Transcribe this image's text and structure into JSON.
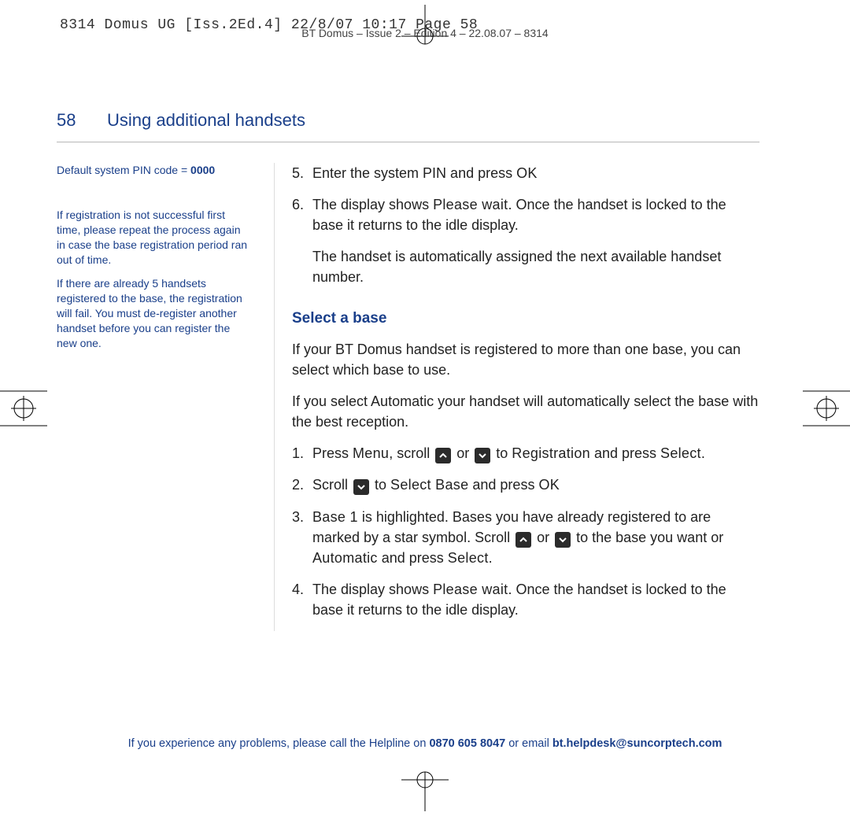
{
  "print_slug": "8314 Domus UG [Iss.2Ed.4]  22/8/07  10:17  Page 58",
  "doc_header": "BT Domus – Issue 2 – Edition 4 – 22.08.07 – 8314",
  "page_number": "58",
  "page_title": "Using additional handsets",
  "sidebar": {
    "pin_prefix": "Default system PIN code = ",
    "pin_value": "0000",
    "note1": "If registration is not successful first time, please repeat the process again in case the base registration period ran out of time.",
    "note2": "If there are already 5 handsets registered to the base, the registration will fail. You must de-register another handset before you can register the new one."
  },
  "main": {
    "step5_num": "5.",
    "step5_a": "Enter the system PIN and press ",
    "step5_ok": "OK",
    "step6_num": "6.",
    "step6_a": "The display shows ",
    "step6_pw": "Please wait",
    "step6_b": ". Once the handset is locked to the base it returns to the idle display.",
    "para_auto_assigned": "The handset is automatically assigned the next available handset number.",
    "section_title": "Select a base",
    "para_multi_base": "If your BT Domus handset is registered to more than one base, you can select which base to use.",
    "para_automatic": "If you select Automatic your handset will automatically select the base with the best reception.",
    "s1_num": "1.",
    "s1_a": "Press ",
    "s1_menu": "Menu",
    "s1_b": ", scroll ",
    "s1_or": " or ",
    "s1_c": " to ",
    "s1_reg": "Registration",
    "s1_d": " and press ",
    "s1_select": "Select",
    "s1_e": ".",
    "s2_num": "2.",
    "s2_a": "Scroll ",
    "s2_b": " to ",
    "s2_sb": "Select Base",
    "s2_c": " and press ",
    "s2_ok": "OK",
    "s3_num": "3.",
    "s3_base1": "Base 1",
    "s3_a": " is highlighted. Bases you have already registered to are marked by a star symbol.  Scroll ",
    "s3_or": " or ",
    "s3_b": " to the base you want or ",
    "s3_auto": "Automatic",
    "s3_c": " and press ",
    "s3_select": "Select",
    "s3_d": ".",
    "s4_num": "4.",
    "s4_a": "The display shows ",
    "s4_pw": "Please wait",
    "s4_b": ". Once the handset is locked to the base it returns to the idle display."
  },
  "footer": {
    "a": "If you experience any problems, please call the Helpline on ",
    "phone": "0870 605 8047",
    "b": " or email ",
    "email": "bt.helpdesk@suncorptech.com"
  }
}
